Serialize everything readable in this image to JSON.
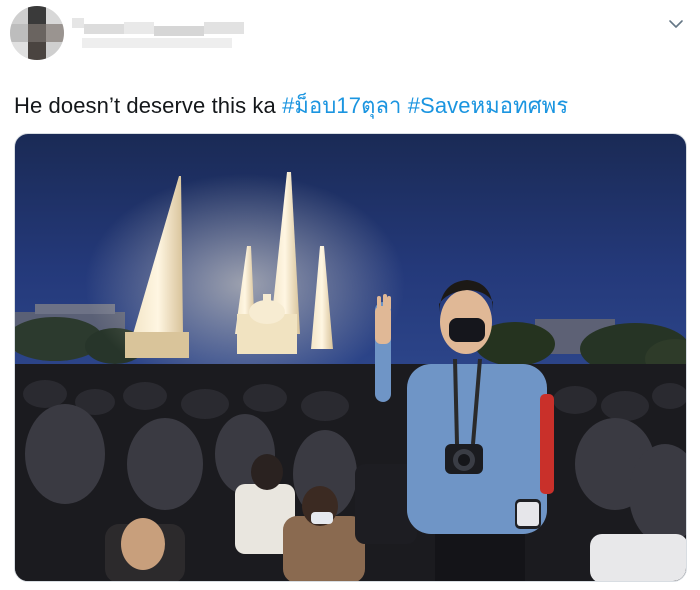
{
  "tweet": {
    "text": "He doesn’t deserve this ka",
    "hashtags": [
      "#ม็อบ17ตุลา",
      "#Saveหมอทศพร"
    ]
  },
  "icons": {
    "menu": "chevron-down-icon"
  },
  "colors": {
    "hashtag": "#1b95e0",
    "text": "#14171a"
  }
}
